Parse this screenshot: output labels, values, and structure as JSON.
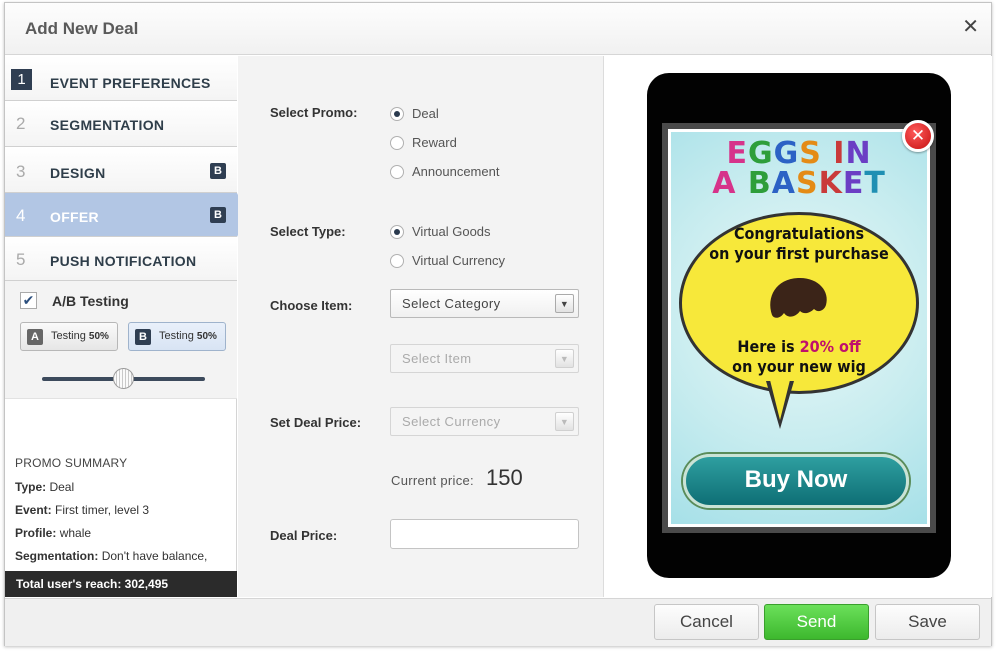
{
  "dialog": {
    "title": "Add New Deal",
    "close_glyph": "✕"
  },
  "steps": [
    {
      "num": "1",
      "label": "EVENT PREFERENCES",
      "badge": ""
    },
    {
      "num": "2",
      "label": "SEGMENTATION",
      "badge": ""
    },
    {
      "num": "3",
      "label": "DESIGN",
      "badge": "B"
    },
    {
      "num": "4",
      "label": "OFFER",
      "badge": "B"
    },
    {
      "num": "5",
      "label": "PUSH NOTIFICATION",
      "badge": ""
    }
  ],
  "ab_testing": {
    "label": "A/B Testing",
    "checked": true,
    "check_glyph": "✔",
    "a": {
      "letter": "A",
      "text": "Testing",
      "pct": "50%"
    },
    "b": {
      "letter": "B",
      "text": "Testing",
      "pct": "50%"
    },
    "split_fraction": 0.5
  },
  "summary": {
    "title": "PROMO SUMMARY",
    "type_label": "Type:",
    "type_value": "Deal",
    "event_label": "Event:",
    "event_value": "First timer, level 3",
    "profile_label": "Profile:",
    "profile_value": "whale",
    "segmentation_label": "Segmentation:",
    "segmentation_value": "Don't have balance,",
    "reach": "Total user's reach: 302,495"
  },
  "form": {
    "promo_label": "Select Promo:",
    "promo_options": [
      "Deal",
      "Reward",
      "Announcement"
    ],
    "promo_selected": "Deal",
    "type_label": "Select Type:",
    "type_options": [
      "Virtual Goods",
      "Virtual Currency"
    ],
    "type_selected": "Virtual Goods",
    "item_label": "Choose Item:",
    "category_placeholder": "Select Category",
    "item_placeholder": "Select Item",
    "deal_price_label": "Set Deal Price:",
    "currency_placeholder": "Select Currency",
    "current_price_label": "Current price:",
    "current_price_value": "150",
    "deal_price_field_label": "Deal Price:",
    "deal_price_value": "",
    "dropdown_glyph": "▼"
  },
  "preview": {
    "logo_line1": "EGGS IN",
    "logo_line2": "A BASKET",
    "logo_colors": [
      "#d6338a",
      "#2e9e3a",
      "#2c62c5",
      "#e48b16",
      "#c93a3a",
      "#6b3ec4",
      "#1f8fb3"
    ],
    "headline1": "Congratulations",
    "headline2": "on your first purchase",
    "offer_prefix": "Here is ",
    "offer_highlight": "20% off",
    "offer_line2": "on your new wig",
    "buy_label": "Buy Now",
    "close_glyph": "✕"
  },
  "footer": {
    "cancel": "Cancel",
    "send": "Send",
    "save": "Save"
  }
}
